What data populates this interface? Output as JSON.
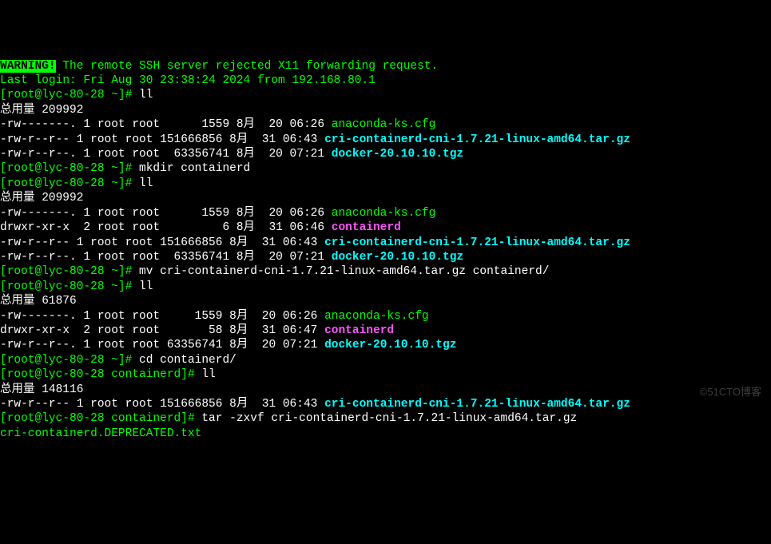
{
  "warning_tag": "WARNING!",
  "warning_msg": " The remote SSH server rejected X11 forwarding request.",
  "last_login": "Last login: Fri Aug 30 23:38:24 2024 from 192.168.80.1",
  "prompts": {
    "home": "[root@lyc-80-28 ~]# ",
    "containerd": "[root@lyc-80-28 containerd]# "
  },
  "cmds": {
    "ll1": "ll",
    "mkdir": "mkdir containerd",
    "ll2": "ll",
    "mv": "mv cri-containerd-cni-1.7.21-linux-amd64.tar.gz containerd/",
    "ll3": "ll",
    "cd": "cd containerd/",
    "ll4": "ll",
    "tar": "tar -zxvf cri-containerd-cni-1.7.21-linux-amd64.tar.gz"
  },
  "totals": {
    "t1": "总用量 209992",
    "t2": "总用量 209992",
    "t3": "总用量 61876",
    "t4": "总用量 148116"
  },
  "ls1": {
    "r1_meta": "-rw-------. 1 root root      1559 8月  20 06:26 ",
    "r1_name": "anaconda-ks.cfg",
    "r2_meta": "-rw-r--r-- 1 root root 151666856 8月  31 06:43 ",
    "r2_name": "cri-containerd-cni-1.7.21-linux-amd64.tar.gz",
    "r3_meta": "-rw-r--r--. 1 root root  63356741 8月  20 07:21 ",
    "r3_name": "docker-20.10.10.tgz"
  },
  "ls2": {
    "r1_meta": "-rw-------. 1 root root      1559 8月  20 06:26 ",
    "r1_name": "anaconda-ks.cfg",
    "r2_meta": "drwxr-xr-x  2 root root         6 8月  31 06:46 ",
    "r2_name": "containerd",
    "r3_meta": "-rw-r--r-- 1 root root 151666856 8月  31 06:43 ",
    "r3_name": "cri-containerd-cni-1.7.21-linux-amd64.tar.gz",
    "r4_meta": "-rw-r--r--. 1 root root  63356741 8月  20 07:21 ",
    "r4_name": "docker-20.10.10.tgz"
  },
  "ls3": {
    "r1_meta": "-rw-------. 1 root root     1559 8月  20 06:26 ",
    "r1_name": "anaconda-ks.cfg",
    "r2_meta": "drwxr-xr-x  2 root root       58 8月  31 06:47 ",
    "r2_name": "containerd",
    "r3_meta": "-rw-r--r--. 1 root root 63356741 8月  20 07:21 ",
    "r3_name": "docker-20.10.10.tgz"
  },
  "ls4": {
    "r1_meta": "-rw-r--r-- 1 root root 151666856 8月  31 06:43 ",
    "r1_name": "cri-containerd-cni-1.7.21-linux-amd64.tar.gz"
  },
  "tar_out": "cri-containerd.DEPRECATED.txt",
  "watermark": "©51CTO博客"
}
